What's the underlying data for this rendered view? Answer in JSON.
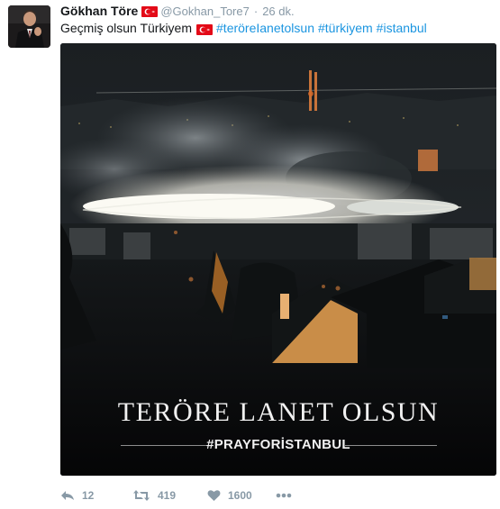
{
  "tweet": {
    "author_name": "Gökhan Töre",
    "handle": "@Gokhan_Tore7",
    "separator": "·",
    "time": "26 dk.",
    "text_plain": "Geçmiş olsun Türkiyem",
    "hashtags": [
      "#teröreIanetolsun",
      "#türkiyem",
      "#istanbul"
    ],
    "flag_icon": "turkey-flag-icon",
    "colors": {
      "link": "#1b95e0",
      "muted": "#8899a6",
      "flag": "#e30a17"
    }
  },
  "media": {
    "caption_main": "TERÖRE LANET OLSUN",
    "caption_sub": "#PRAYFORİSTANBUL"
  },
  "actions": {
    "reply_count": "12",
    "retweet_count": "419",
    "like_count": "1600",
    "reply_icon": "reply-icon",
    "retweet_icon": "retweet-icon",
    "like_icon": "heart-icon",
    "more_icon": "more-icon"
  }
}
